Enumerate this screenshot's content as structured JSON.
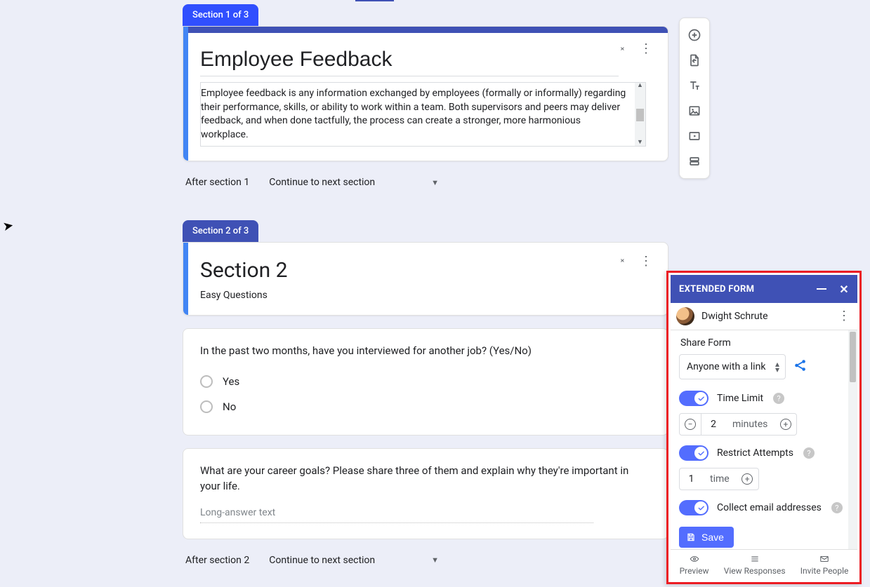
{
  "toolbar": {
    "items": [
      "add-question",
      "import-questions",
      "add-title",
      "add-image",
      "add-video",
      "add-section"
    ]
  },
  "section1": {
    "tab": "Section 1 of 3",
    "title": "Employee Feedback",
    "description": "Employee feedback is any information exchanged by employees (formally or informally) regarding their performance, skills, or ability to work within a team. Both supervisors and peers may deliver feedback, and when done tactfully, the process can create a stronger, more harmonious workplace.",
    "after_label": "After section 1",
    "after_select": "Continue to next section"
  },
  "section2": {
    "tab": "Section 2 of 3",
    "title": "Section 2",
    "subtitle": "Easy Questions",
    "after_label": "After section 2",
    "after_select": "Continue to next section",
    "questions": [
      {
        "text": "In the past two months, have you interviewed for another job? (Yes/No)",
        "type": "radio",
        "options": [
          "Yes",
          "No"
        ]
      },
      {
        "text": "What are your career goals? Please share three of them and explain why they're important in your life.",
        "type": "long",
        "placeholder": "Long-answer text"
      }
    ]
  },
  "panel": {
    "title": "EXTENDED FORM",
    "user": "Dwight Schrute",
    "share": {
      "label": "Share Form",
      "select": "Anyone with a link"
    },
    "time_limit": {
      "label": "Time Limit",
      "value": "2",
      "unit": "minutes",
      "on": true
    },
    "restrict": {
      "label": "Restrict Attempts",
      "value": "1",
      "unit": "time",
      "on": true
    },
    "collect": {
      "label": "Collect email addresses",
      "on": true
    },
    "save": "Save",
    "footer": {
      "preview": "Preview",
      "responses": "View Responses",
      "invite": "Invite People"
    }
  }
}
